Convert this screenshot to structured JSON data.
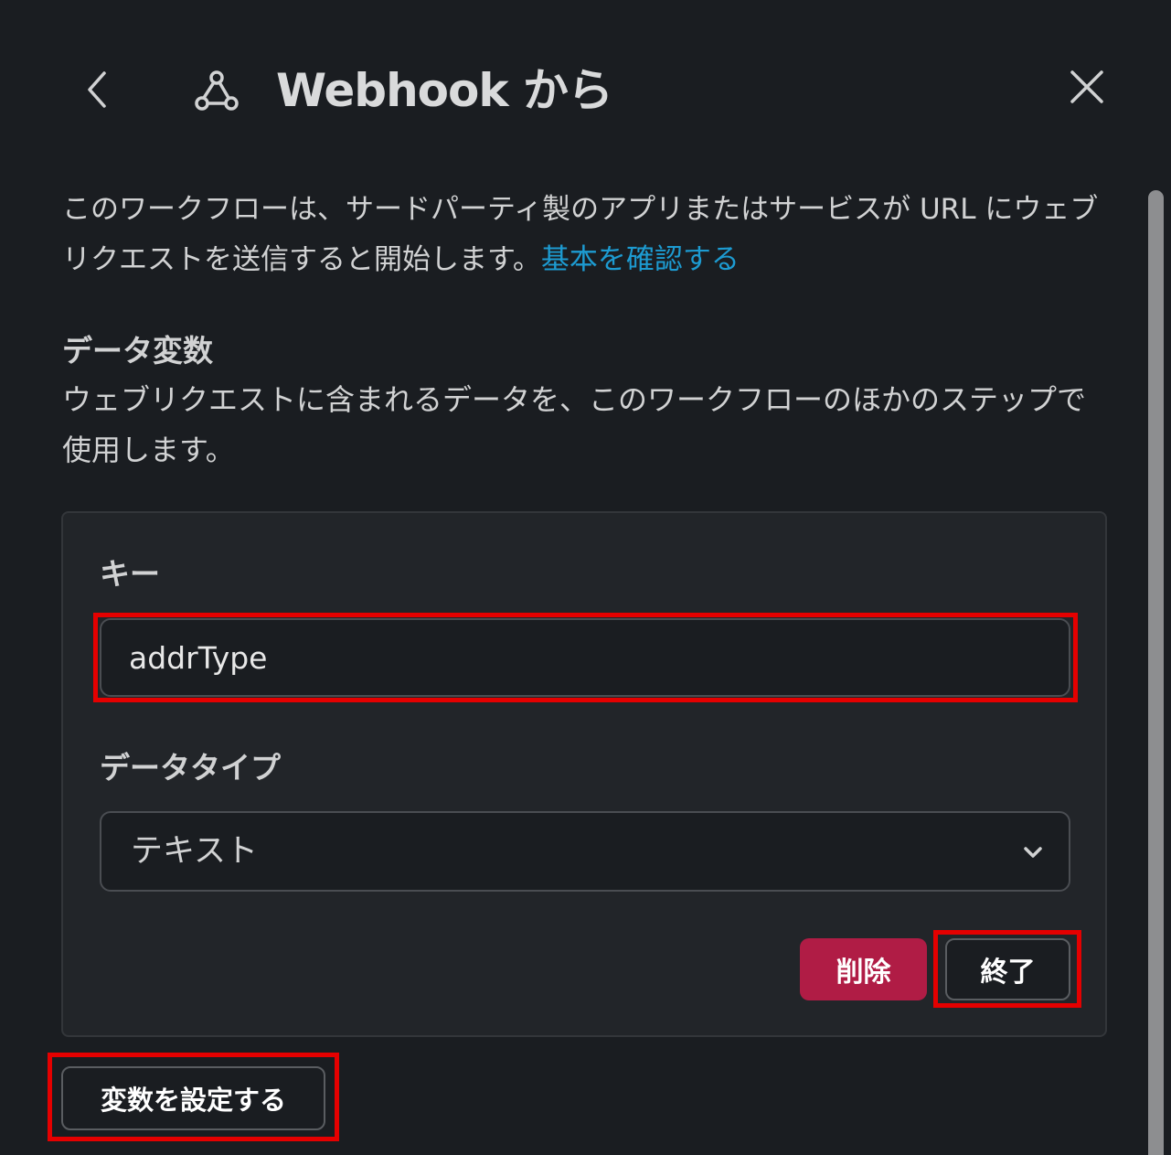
{
  "header": {
    "title": "Webhook から",
    "back_icon": "chevron-left-icon",
    "webhook_icon": "webhook-icon",
    "close_icon": "close-icon"
  },
  "description": {
    "text": "このワークフローは、サードパーティ製のアプリまたはサービスが URL にウェブリクエストを送信すると開始します。",
    "link": "基本を確認する"
  },
  "data_variables": {
    "heading": "データ変数",
    "description": "ウェブリクエストに含まれるデータを、このワークフローのほかのステップで使用します。",
    "card": {
      "key_label": "キー",
      "key_value": "addrType",
      "type_label": "データタイプ",
      "type_value": "テキスト",
      "delete_label": "削除",
      "done_label": "終了"
    },
    "set_variable_label": "変数を設定する"
  },
  "colors": {
    "background": "#1a1d21",
    "card": "#222529",
    "link": "#1d9bd1",
    "danger": "#b01c45",
    "highlight": "#e50000"
  }
}
